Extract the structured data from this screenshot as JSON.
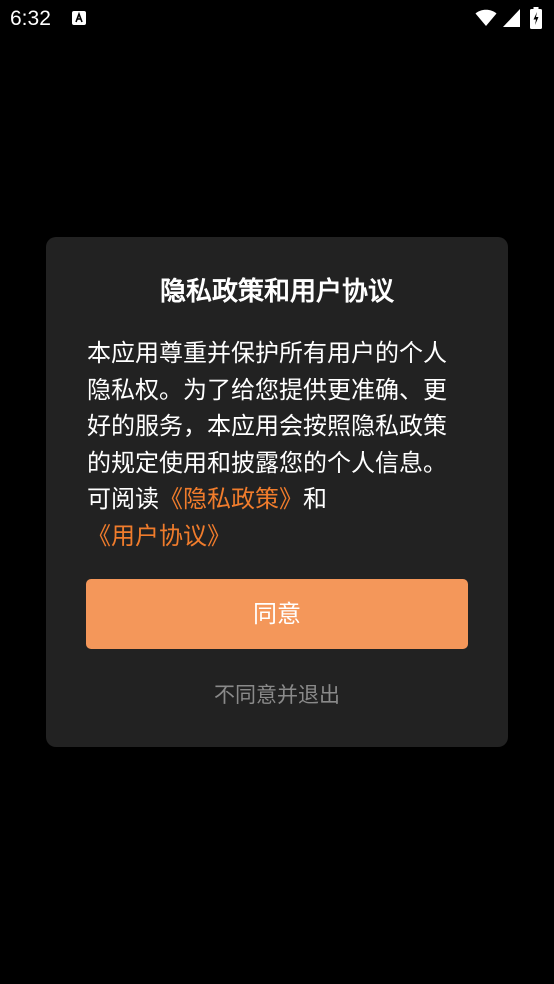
{
  "status_bar": {
    "time": "6:32",
    "notification_icon": "accessibility-a-icon",
    "wifi_icon": "wifi-icon",
    "signal_icon": "cell-signal-icon",
    "battery_icon": "battery-charging-icon"
  },
  "dialog": {
    "title": "隐私政策和用户协议",
    "body_text": "本应用尊重并保护所有用户的个人隐私权。为了给您提供更准确、更好的服务，本应用会按照隐私政策的规定使用和披露您的个人信息。可阅读",
    "privacy_link": "《隐私政策》",
    "conjunction": "和",
    "user_agreement_link": "《用户协议》",
    "agree_label": "同意",
    "disagree_label": "不同意并退出"
  },
  "colors": {
    "background": "#000000",
    "dialog_background": "#222222",
    "accent_button": "#f4975a",
    "link": "#f07c2c",
    "secondary_text": "#8a8a8a"
  }
}
